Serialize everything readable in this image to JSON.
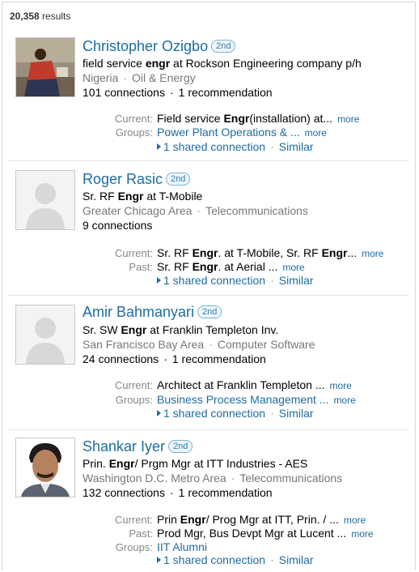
{
  "results": {
    "count": "20,358",
    "label": "results"
  },
  "people": [
    {
      "name": "Christopher Ozigbo",
      "degree": "2nd",
      "headline_pre": "field service ",
      "headline_bold": "engr",
      "headline_post": " at Rockson Engineering company p/h",
      "location": "Nigeria",
      "industry": "Oil & Energy",
      "connections": "101 connections",
      "recommendation": "1 recommendation",
      "photo": "user-photo",
      "details": [
        {
          "label": "Current:",
          "pre": "Field service ",
          "bold": "Engr",
          "post": "(installation) at...",
          "more": "more",
          "is_link": false
        },
        {
          "label": "Groups:",
          "pre": "Power Plant Operations & ...",
          "bold": "",
          "post": "",
          "more": "more",
          "is_link": true
        }
      ],
      "shared": "1 shared connection",
      "similar": "Similar"
    },
    {
      "name": "Roger Rasic",
      "degree": "2nd",
      "headline_pre": "Sr. RF ",
      "headline_bold": "Engr",
      "headline_post": " at T-Mobile",
      "location": "Greater Chicago Area",
      "industry": "Telecommunications",
      "connections": "9 connections",
      "recommendation": "",
      "photo": "placeholder-avatar",
      "details": [
        {
          "label": "Current:",
          "pre": "Sr. RF ",
          "bold": "Engr",
          "post": ". at T-Mobile, Sr. RF ",
          "bold2": "Engr",
          "post2": "...",
          "more": "more",
          "is_link": false
        },
        {
          "label": "Past:",
          "pre": "Sr. RF ",
          "bold": "Engr",
          "post": ". at Aerial ...",
          "more": "more",
          "is_link": false
        }
      ],
      "shared": "1 shared connection",
      "similar": "Similar"
    },
    {
      "name": "Amir Bahmanyari",
      "degree": "2nd",
      "headline_pre": "Sr. SW ",
      "headline_bold": "Engr",
      "headline_post": " at Franklin Templeton Inv.",
      "location": "San Francisco Bay Area",
      "industry": "Computer Software",
      "connections": "24 connections",
      "recommendation": "1 recommendation",
      "photo": "placeholder-avatar",
      "details": [
        {
          "label": "Current:",
          "pre": "Architect at Franklin Templeton ...",
          "bold": "",
          "post": "",
          "more": "more",
          "is_link": false
        },
        {
          "label": "Groups:",
          "pre": "Business Process Management ...",
          "bold": "",
          "post": "",
          "more": "more",
          "is_link": true
        }
      ],
      "shared": "1 shared connection",
      "similar": "Similar"
    },
    {
      "name": "Shankar Iyer",
      "degree": "2nd",
      "headline_pre": "Prin. ",
      "headline_bold": "Engr",
      "headline_post": "/ Prgm Mgr at ITT Industries - AES",
      "location": "Washington D.C. Metro Area",
      "industry": "Telecommunications",
      "connections": "132 connections",
      "recommendation": "1 recommendation",
      "photo": "user-photo",
      "details": [
        {
          "label": "Current:",
          "pre": "Prin ",
          "bold": "Engr",
          "post": "/ Prog Mgr at ITT, Prin. / ...",
          "more": "more",
          "is_link": false
        },
        {
          "label": "Past:",
          "pre": "Prod Mgr, Bus Devpt Mgr at Lucent ...",
          "bold": "",
          "post": "",
          "more": "more",
          "is_link": false
        },
        {
          "label": "Groups:",
          "pre": "IIT Alumni",
          "bold": "",
          "post": "",
          "more": "",
          "is_link": true
        }
      ],
      "shared": "1 shared connection",
      "similar": "Similar"
    }
  ]
}
